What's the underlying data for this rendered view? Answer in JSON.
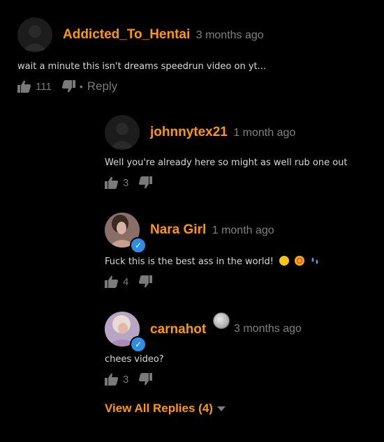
{
  "comments": [
    {
      "username": "Addicted_To_Hentai",
      "time": "3 months ago",
      "text": "wait a minute this isn't dreams speedrun video on yt...",
      "likes": "111",
      "reply_label": "Reply",
      "separator": "•"
    },
    {
      "username": "johnnytex21",
      "time": "1 month ago",
      "text": "Well you're already here so might as well rub one out",
      "likes": "3"
    },
    {
      "username": "Nara Girl",
      "time": "1 month ago",
      "text": "Fuck this is the best ass in the world!",
      "likes": "4"
    },
    {
      "username": "carnahot",
      "time": "3 months ago",
      "text": "chees video?",
      "likes": "3"
    }
  ],
  "view_all_replies": "View All Replies (4)",
  "icons": {
    "like": "thumbs-up-icon",
    "dislike": "thumbs-down-icon",
    "verified": "verified-check-icon",
    "caret": "caret-down-icon"
  },
  "colors": {
    "accent": "#ff9900",
    "muted": "#808080",
    "verified": "#2f8de4",
    "background": "#000000"
  }
}
